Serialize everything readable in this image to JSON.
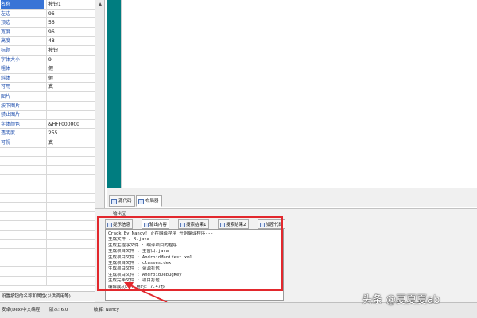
{
  "properties": [
    {
      "key": "名称",
      "value": "按钮1"
    },
    {
      "key": "左边",
      "value": "96"
    },
    {
      "key": "顶边",
      "value": "56"
    },
    {
      "key": "宽度",
      "value": "96"
    },
    {
      "key": "高度",
      "value": "48"
    },
    {
      "key": "标题",
      "value": "按钮"
    },
    {
      "key": "字体大小",
      "value": "9"
    },
    {
      "key": "粗体",
      "value": "假"
    },
    {
      "key": "斜体",
      "value": "假"
    },
    {
      "key": "可用",
      "value": "真"
    },
    {
      "key": "图片",
      "value": ""
    },
    {
      "key": "按下图片",
      "value": ""
    },
    {
      "key": "禁止图片",
      "value": ""
    },
    {
      "key": "字体颜色",
      "value": "&HFF000000"
    },
    {
      "key": "透明度",
      "value": "255"
    },
    {
      "key": "可视",
      "value": "真"
    }
  ],
  "hint_text": "设置按钮的名称和属性(以供调用等)",
  "designer_tabs": [
    {
      "label": "源代码"
    },
    {
      "label": "布局器"
    }
  ],
  "output": {
    "title": "输出区",
    "tabs": [
      {
        "label": "提示信息"
      },
      {
        "label": "输出内容"
      },
      {
        "label": "搜索结果1"
      },
      {
        "label": "搜索结果2"
      },
      {
        "label": "加密代码"
      }
    ],
    "lines": [
      "Crack By Nancy! 正在编译程序 开始编译程序---",
      "生成文件 : R.java",
      "生成主程序文件 : 编译项目的程序",
      "生成项目文件 : 主窗口.java",
      "生成项目文件 : AndroidManifest.xml",
      "生成项目文件 : classes.dex",
      "生成项目文件 : 资源打包",
      "生成项目文件 : AndroidDebugKey",
      "生成完毕文件 : 项目打包",
      "编译成功... 用时: 7.47秒"
    ]
  },
  "status": {
    "encoding": "安卓(Dex)中文编程",
    "version": "版本: 6.0",
    "cracked": "破解: Nancy"
  },
  "watermark": "头条 @夏夏夏ab",
  "colors": {
    "teal": "#007d80",
    "highlight_box": "#e2282d",
    "selected_row": "#3874d6"
  }
}
